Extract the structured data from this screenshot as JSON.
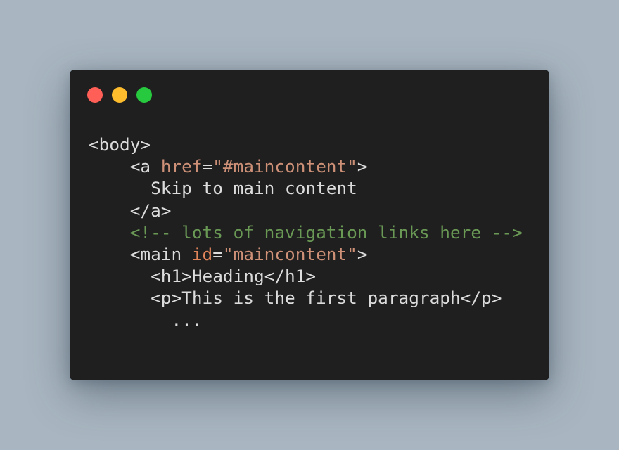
{
  "window": {
    "controls": [
      {
        "name": "close",
        "color": "#ff5f56"
      },
      {
        "name": "minimize",
        "color": "#ffbd2e"
      },
      {
        "name": "zoom",
        "color": "#27c93f"
      }
    ]
  },
  "code": {
    "lines": [
      {
        "indent": "",
        "tokens": [
          {
            "type": "tag",
            "text": "<body>"
          }
        ]
      },
      {
        "indent": "    ",
        "tokens": [
          {
            "type": "tag",
            "text": "<a "
          },
          {
            "type": "attr",
            "text": "href"
          },
          {
            "type": "tag",
            "text": "="
          },
          {
            "type": "str",
            "text": "\"#maincontent\""
          },
          {
            "type": "tag",
            "text": ">"
          }
        ]
      },
      {
        "indent": "      ",
        "tokens": [
          {
            "type": "text",
            "text": "Skip to main content"
          }
        ]
      },
      {
        "indent": "    ",
        "tokens": [
          {
            "type": "tag",
            "text": "</a>"
          }
        ]
      },
      {
        "indent": "    ",
        "tokens": [
          {
            "type": "comment",
            "text": "<!-- lots of navigation links here -->"
          }
        ]
      },
      {
        "indent": "    ",
        "tokens": [
          {
            "type": "tag",
            "text": "<main "
          },
          {
            "type": "attrc",
            "text": "id"
          },
          {
            "type": "tag",
            "text": "="
          },
          {
            "type": "str",
            "text": "\"maincontent\""
          },
          {
            "type": "tag",
            "text": ">"
          }
        ]
      },
      {
        "indent": "      ",
        "tokens": [
          {
            "type": "tag",
            "text": "<h1>Heading</h1>"
          }
        ]
      },
      {
        "indent": "      ",
        "tokens": [
          {
            "type": "tag",
            "text": "<p>This is the first paragraph</p>"
          }
        ]
      },
      {
        "indent": "        ",
        "tokens": [
          {
            "type": "text",
            "text": "..."
          }
        ]
      }
    ]
  }
}
